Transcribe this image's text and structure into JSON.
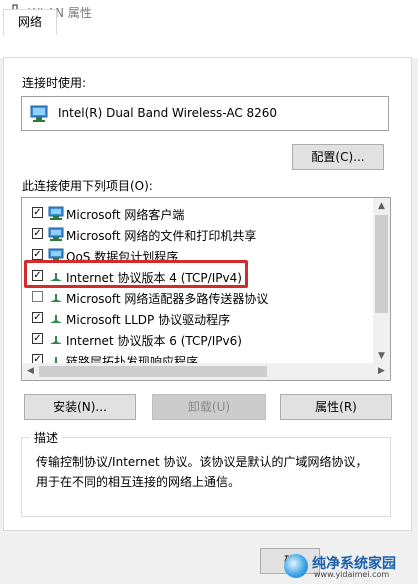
{
  "window": {
    "title": "WLAN 属性"
  },
  "tabs": [
    {
      "label": "网络"
    }
  ],
  "connect_using": {
    "label": "连接时使用:",
    "adapter": "Intel(R) Dual Band Wireless-AC 8260",
    "configure_button": "配置(C)..."
  },
  "items_section": {
    "label": "此连接使用下列项目(O):",
    "items": [
      {
        "checked": true,
        "label": "Microsoft 网络客户端"
      },
      {
        "checked": true,
        "label": "Microsoft 网络的文件和打印机共享"
      },
      {
        "checked": true,
        "label": "QoS 数据包计划程序"
      },
      {
        "checked": true,
        "label": "Internet 协议版本 4 (TCP/IPv4)"
      },
      {
        "checked": false,
        "label": "Microsoft 网络适配器多路传送器协议"
      },
      {
        "checked": true,
        "label": "Microsoft LLDP 协议驱动程序"
      },
      {
        "checked": true,
        "label": "Internet 协议版本 6 (TCP/IPv6)"
      },
      {
        "checked": true,
        "label": "链路层拓扑发现响应程序"
      }
    ]
  },
  "buttons": {
    "install": "安装(N)...",
    "uninstall": "卸载(U)",
    "properties": "属性(R)",
    "bottom_partial": "确"
  },
  "description": {
    "title": "描述",
    "text": "传输控制协议/Internet 协议。该协议是默认的广域网络协议，用于在不同的相互连接的网络上通信。"
  },
  "watermark": {
    "title": "纯净系统家园",
    "url": "www.yidaimei.com"
  },
  "colors": {
    "highlight": "#d32a2a",
    "panel_bg": "#ffffff",
    "window_bg": "#f0f0f0"
  }
}
